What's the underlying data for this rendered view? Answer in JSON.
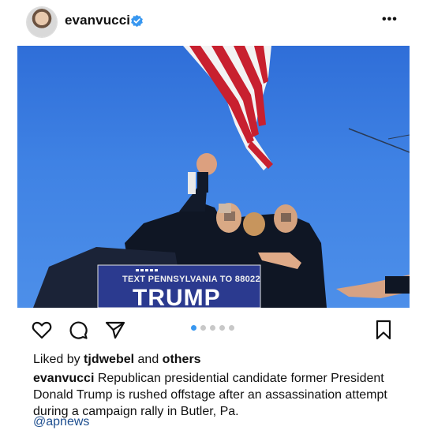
{
  "post": {
    "username": "evanvucci",
    "photo": {
      "sign_text": "TEXT PENNSYLVANIA TO 88022",
      "sign_name": "TRUMP"
    },
    "carousel": {
      "total": 5,
      "active": 0
    },
    "liked_by_prefix": "Liked by",
    "liked_by_user": "tjdwebel",
    "liked_by_and": "and",
    "liked_by_others": "others",
    "caption_user": "evanvucci",
    "caption_text": "Republican presidential candidate former President Donald Trump is rushed offstage after an assassination attempt during a campaign rally in Butler, Pa.",
    "mention": "@apnews"
  },
  "colors": {
    "accent": "#3897f0",
    "mention": "#1d4e8f"
  },
  "icons": [
    "verified-badge-icon",
    "more-options-icon",
    "heart-icon",
    "comment-icon",
    "share-icon",
    "bookmark-icon"
  ]
}
